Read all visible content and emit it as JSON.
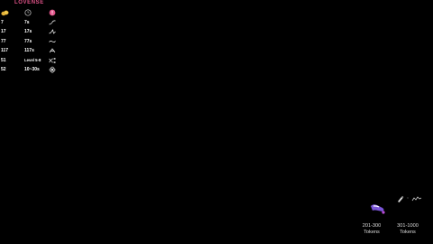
{
  "brand": {
    "name": "LOVENSE"
  },
  "header_icons": [
    "coins-icon",
    "clock-icon",
    "vibration-icon"
  ],
  "levels": [
    {
      "tokens": "7",
      "duration": "7s",
      "pattern_icon": "rise-wave-icon"
    },
    {
      "tokens": "17",
      "duration": "17s",
      "pattern_icon": "peak-wave-icon"
    },
    {
      "tokens": "77",
      "duration": "77s",
      "pattern_icon": "tilde-wave-icon"
    },
    {
      "tokens": "117",
      "duration": "117s",
      "pattern_icon": "triangle-wave-icon"
    },
    {
      "tokens": "51",
      "duration": "Level 5-8",
      "pattern_icon": "shuffle-icon"
    },
    {
      "tokens": "52",
      "duration": "10~30s",
      "pattern_icon": "flower-icon"
    }
  ],
  "tiers": [
    {
      "range": "201-300",
      "unit": "Tokens"
    },
    {
      "range": "301-1000",
      "unit": "Tokens"
    }
  ],
  "colors": {
    "brand": "#e2548a",
    "coin": "#e8b53a",
    "toy": "#7a55d8",
    "background": "#000000"
  }
}
